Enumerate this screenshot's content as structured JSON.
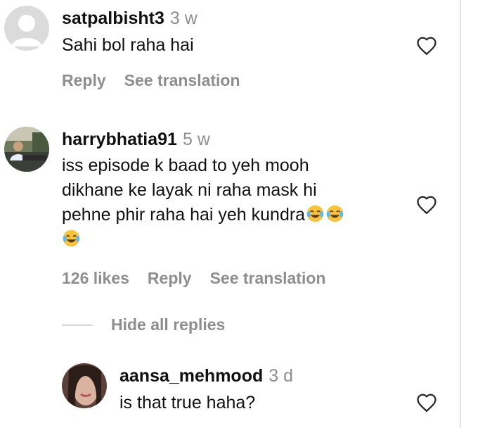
{
  "comments": [
    {
      "username": "satpalbisht3",
      "time": "3 w",
      "text": "Sahi bol raha hai",
      "actions": {
        "reply": "Reply",
        "translate": "See translation"
      }
    },
    {
      "username": "harrybhatia91",
      "time": "5 w",
      "lines": [
        "iss episode k baad to yeh mooh",
        "dikhane ke layak ni raha mask hi",
        "pehne phir raha hai yeh kundra"
      ],
      "emoji_name": "face-with-tears-of-joy",
      "likes": "126 likes",
      "actions": {
        "reply": "Reply",
        "translate": "See translation"
      }
    }
  ],
  "replies_toggle": "Hide all replies",
  "reply": {
    "username": "aansa_mehmood",
    "time": "3 d",
    "text": "is that true haha?"
  },
  "colors": {
    "text": "#111111",
    "muted": "#8e8e8e",
    "divider": "#e3e3e3"
  }
}
